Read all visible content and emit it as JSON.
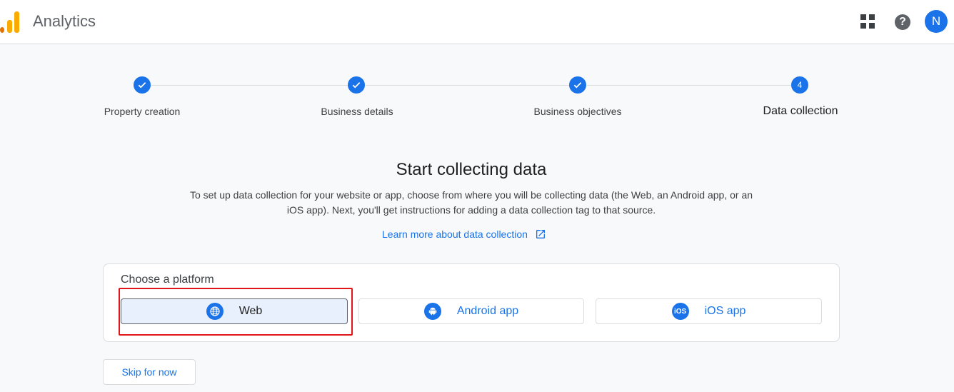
{
  "header": {
    "app_title": "Analytics",
    "logo_colors": [
      "#f9ab00",
      "#e37400"
    ],
    "apps_icon": "apps-grid-icon",
    "help_icon": "help-icon",
    "avatar_letter": "N"
  },
  "stepper": {
    "steps": [
      {
        "label": "Property creation",
        "state": "done"
      },
      {
        "label": "Business details",
        "state": "done"
      },
      {
        "label": "Business objectives",
        "state": "done"
      },
      {
        "label": "Data collection",
        "state": "active",
        "number": "4"
      }
    ]
  },
  "main": {
    "title": "Start collecting data",
    "description": "To set up data collection for your website or app, choose from where you will be collecting data (the Web, an Android app, or an iOS app). Next, you'll get instructions for adding a data collection tag to that source.",
    "learn_more": "Learn more about data collection",
    "platform": {
      "title": "Choose a platform",
      "options": [
        {
          "label": "Web",
          "icon": "globe-icon",
          "selected": true
        },
        {
          "label": "Android app",
          "icon": "android-icon",
          "selected": false
        },
        {
          "label": "iOS app",
          "icon": "ios-icon",
          "selected": false,
          "icon_text": "iOS"
        }
      ]
    },
    "skip": "Skip for now"
  },
  "colors": {
    "accent": "#1a73e8",
    "highlight_box": "#e0161b",
    "selected_bg": "#e8f0fe"
  }
}
